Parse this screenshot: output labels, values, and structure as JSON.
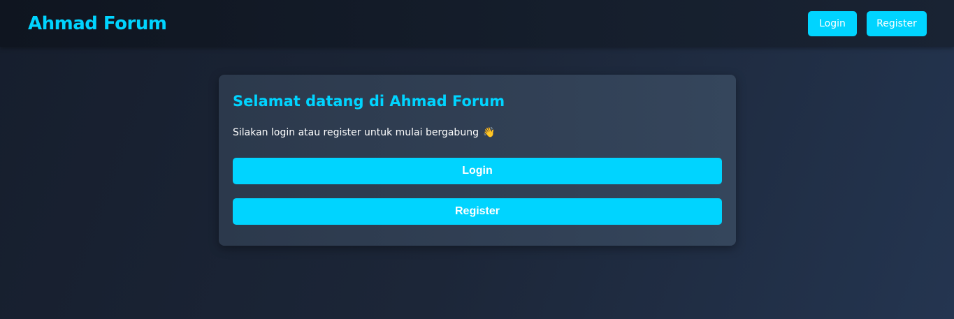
{
  "navbar": {
    "brand": "Ahmad Forum",
    "login_label": "Login",
    "register_label": "Register"
  },
  "welcome_card": {
    "title": "Selamat datang di Ahmad Forum",
    "message": "Silakan login atau register untuk mulai bergabung",
    "message_emoji": "👋",
    "login_label": "Login",
    "register_label": "Register"
  },
  "colors": {
    "accent": "#00d4ff",
    "navbar_bg": "#131b28",
    "page_bg": "#1c2638",
    "card_bg": "#314055",
    "button_text": "#ffffff"
  }
}
